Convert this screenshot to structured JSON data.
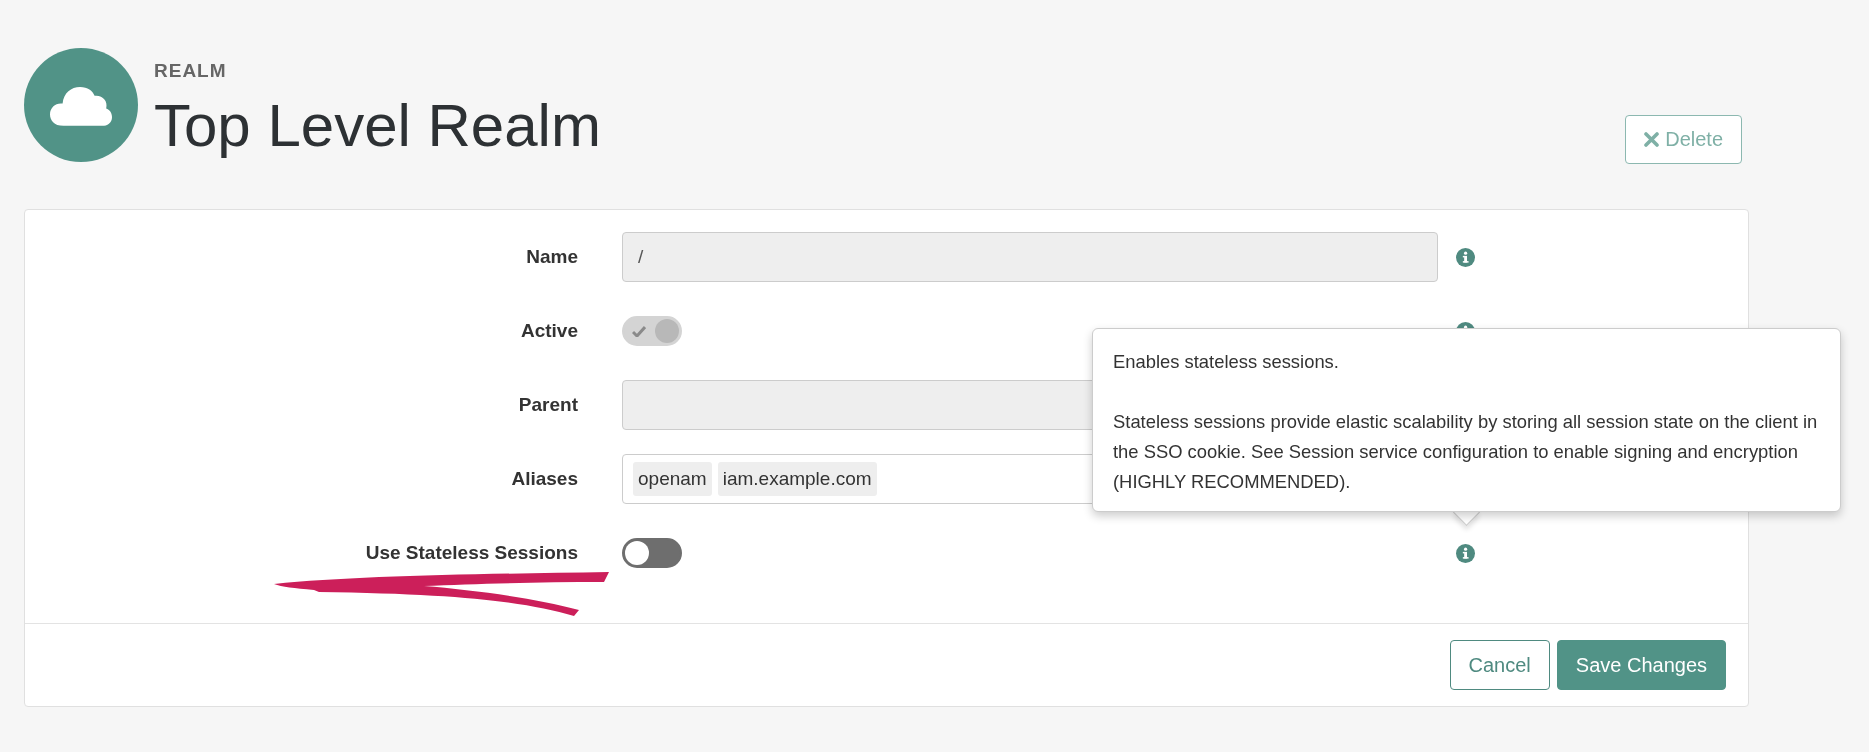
{
  "header": {
    "eyebrow": "REALM",
    "title": "Top Level Realm"
  },
  "delete_button": {
    "label": "Delete"
  },
  "fields": [
    {
      "kind": "text",
      "label": "Name",
      "value": "/",
      "disabled": true,
      "marked": false,
      "info": true
    },
    {
      "kind": "toggle",
      "label": "Active",
      "on": true,
      "disabled": true,
      "marked": false,
      "info": true
    },
    {
      "kind": "text",
      "label": "Parent",
      "disabled": true,
      "marked": false,
      "info": false
    },
    {
      "kind": "tags",
      "label": "Aliases",
      "tags": [
        "openam",
        "iam.example.com"
      ],
      "disabled": false,
      "marked": false,
      "info": false
    },
    {
      "kind": "toggle",
      "label": "Use Stateless Sessions",
      "on": false,
      "disabled": false,
      "marked": true,
      "info": true
    }
  ],
  "tooltip": {
    "paragraphs": [
      "Enables stateless sessions.",
      "Stateless sessions provide elastic scalability by storing all session state on the client in the SSO cookie. See Session service configuration to enable signing and encryption (HIGHLY RECOMMENDED)."
    ]
  },
  "footer_buttons": [
    {
      "kind": "secondary",
      "label": "Cancel"
    },
    {
      "kind": "primary",
      "label": "Save Changes"
    }
  ]
}
